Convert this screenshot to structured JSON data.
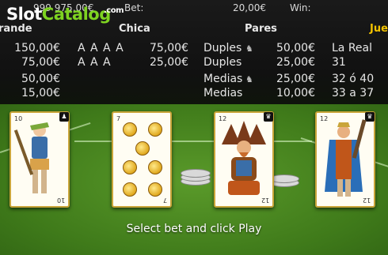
{
  "watermark": {
    "slot": "Slot",
    "catalog": "Catalog",
    "com": ".com"
  },
  "header": {
    "balance": "999 975,00€",
    "bet_label": "Bet:",
    "bet_value": "20,00€",
    "win_label": "Win:",
    "win_value": ""
  },
  "categories": {
    "grande": "rande",
    "chica": "Chica",
    "pares": "Pares",
    "juego": "Jue"
  },
  "grande_rows": [
    "150,00€",
    "75,00€",
    "50,00€",
    "15,00€"
  ],
  "chica_hands": [
    "A A A A",
    "A A A"
  ],
  "chica_values": [
    "75,00€",
    "25,00€"
  ],
  "pares_rows": [
    {
      "label": "Duples",
      "value": "50,00€",
      "icon": "tiger-icon"
    },
    {
      "label": "Duples",
      "value": "25,00€",
      "icon": ""
    },
    {
      "label": "Medias",
      "value": "25,00€",
      "icon": "tiger-icon"
    },
    {
      "label": "Medias",
      "value": "10,00€",
      "icon": ""
    }
  ],
  "juego_rows": [
    "La Real",
    "31",
    "32 ó 40",
    "33 a 37"
  ],
  "cards": [
    {
      "index": "10",
      "figure": "sota",
      "badge": "♟"
    },
    {
      "index": "7",
      "figure": "oros",
      "badge": ""
    },
    {
      "index": "12",
      "figure": "rey",
      "badge": "♛"
    },
    {
      "index": "12",
      "figure": "rey",
      "badge": "♛"
    }
  ],
  "prompt": "Select bet and click Play",
  "colors": {
    "accent": "#f2c200",
    "felt": "#3f7a1a",
    "panel": "#111111"
  }
}
